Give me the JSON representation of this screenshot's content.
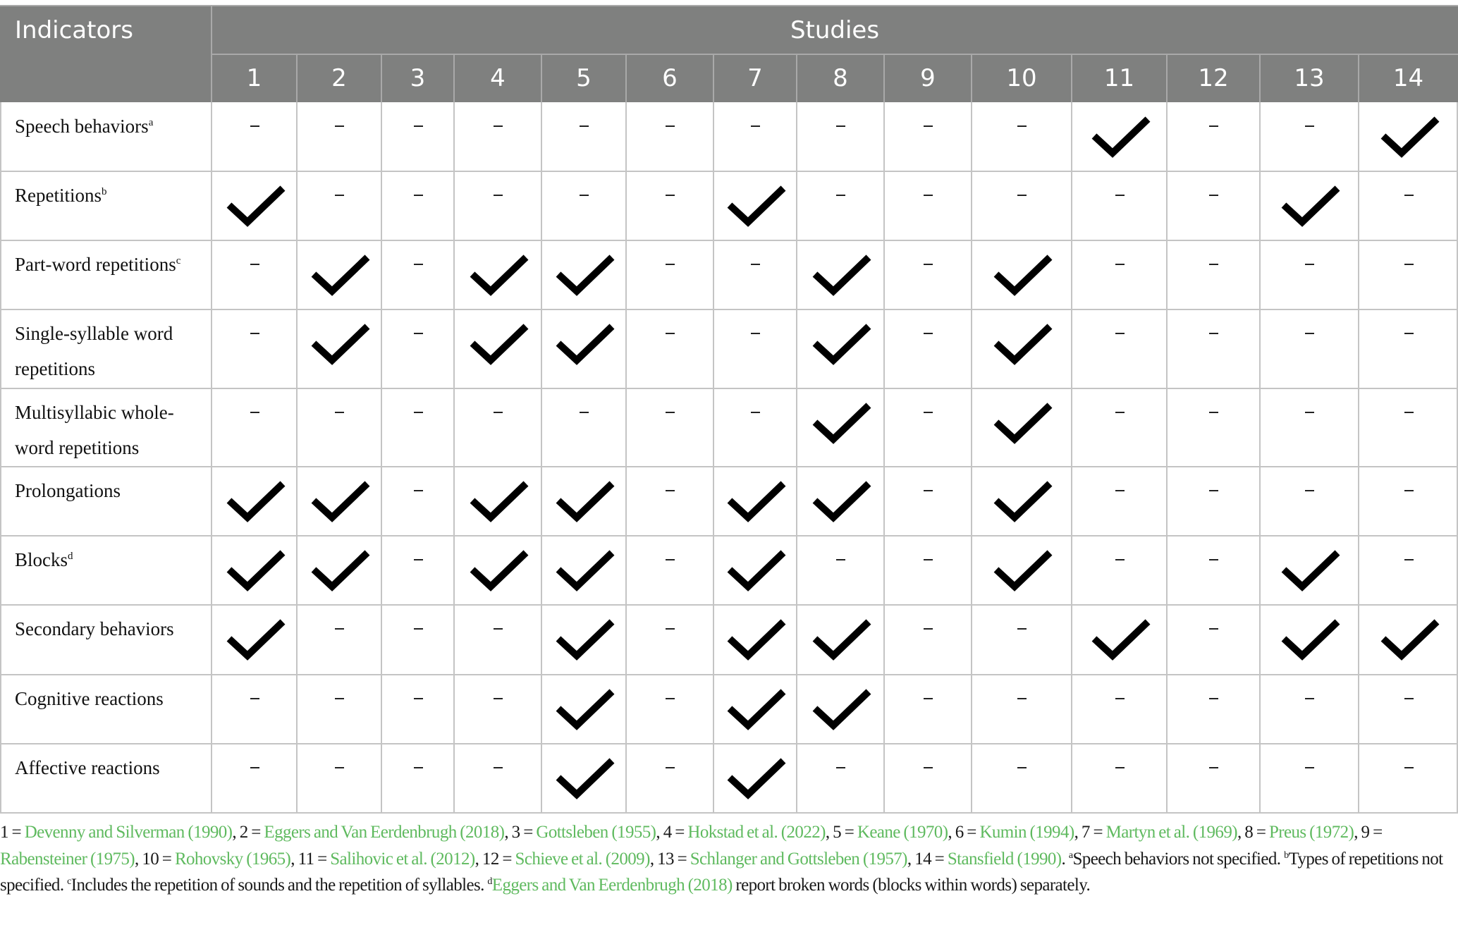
{
  "header": {
    "indicators_label": "Indicators",
    "studies_label": "Studies",
    "study_numbers": [
      "1",
      "2",
      "3",
      "4",
      "5",
      "6",
      "7",
      "8",
      "9",
      "10",
      "11",
      "12",
      "13",
      "14"
    ]
  },
  "symbols": {
    "present": "check-icon",
    "absent": "–"
  },
  "rows": [
    {
      "label": "Speech behaviors",
      "sup": "a",
      "checked": [
        11,
        14
      ]
    },
    {
      "label": "Repetitions",
      "sup": "b",
      "checked": [
        1,
        7,
        13
      ]
    },
    {
      "label": "Part-word repetitions",
      "sup": "c",
      "checked": [
        2,
        4,
        5,
        8,
        10
      ]
    },
    {
      "label": "Single-syllable word repetitions",
      "sup": "",
      "lines": [
        "Single-syllable word",
        "repetitions"
      ],
      "checked": [
        2,
        4,
        5,
        8,
        10
      ]
    },
    {
      "label": "Multisyllabic whole-word repetitions",
      "sup": "",
      "lines": [
        "Multisyllabic whole-",
        "word repetitions"
      ],
      "checked": [
        8,
        10
      ]
    },
    {
      "label": "Prolongations",
      "sup": "",
      "checked": [
        1,
        2,
        4,
        5,
        7,
        8,
        10
      ]
    },
    {
      "label": "Blocks",
      "sup": "d",
      "checked": [
        1,
        2,
        4,
        5,
        7,
        10,
        13
      ]
    },
    {
      "label": "Secondary behaviors",
      "sup": "",
      "checked": [
        1,
        5,
        7,
        8,
        11,
        13,
        14
      ]
    },
    {
      "label": "Cognitive reactions",
      "sup": "",
      "checked": [
        5,
        7,
        8
      ]
    },
    {
      "label": "Affective reactions",
      "sup": "",
      "checked": [
        5,
        7
      ]
    }
  ],
  "footnote": {
    "studies": [
      {
        "num": "1",
        "ref": "Devenny and Silverman (1990)"
      },
      {
        "num": "2",
        "ref": "Eggers and Van Eerdenbrugh (2018)"
      },
      {
        "num": "3",
        "ref": "Gottsleben (1955)"
      },
      {
        "num": "4",
        "ref": "Hokstad et al. (2022)"
      },
      {
        "num": "5",
        "ref": "Keane (1970)"
      },
      {
        "num": "6",
        "ref": "Kumin (1994)"
      },
      {
        "num": "7",
        "ref": "Martyn et al. (1969)"
      },
      {
        "num": "8",
        "ref": "Preus (1972)"
      },
      {
        "num": "9",
        "ref": "Rabensteiner (1975)"
      },
      {
        "num": "10",
        "ref": "Rohovsky (1965)"
      },
      {
        "num": "11",
        "ref": "Salihovic et al. (2012)"
      },
      {
        "num": "12",
        "ref": "Schieve et al. (2009)"
      },
      {
        "num": "13",
        "ref": "Schlanger and Gottsleben (1957)"
      },
      {
        "num": "14",
        "ref": "Stansfield (1990)"
      }
    ],
    "notes": [
      {
        "sup": "a",
        "text": "Speech behaviors not specified."
      },
      {
        "sup": "b",
        "text": "Types of repetitions not specified."
      },
      {
        "sup": "c",
        "text": "Includes the repetition of sounds and the repetition of syllables."
      },
      {
        "sup": "d",
        "ref": "Eggers and Van Eerdenbrugh (2018)",
        "text": " report broken words (blocks within words) separately."
      }
    ],
    "link_color": "#5fba5f"
  },
  "colors": {
    "header_bg": "#7f807f",
    "header_text": "#ffffff",
    "grid_line": "#c4c4c4"
  }
}
